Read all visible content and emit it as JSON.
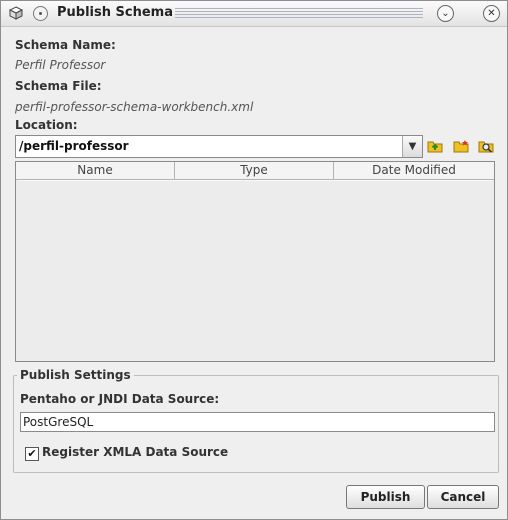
{
  "window": {
    "title": "Publish Schema",
    "icons": {
      "app": "cube-icon",
      "menu": "circle-menu-icon",
      "chevron": "chevron-down-icon",
      "close": "close-icon"
    }
  },
  "schema": {
    "name_label": "Schema Name:",
    "name_value": "Perfil Professor",
    "file_label": "Schema File:",
    "file_value": "perfil-professor-schema-workbench.xml"
  },
  "location": {
    "label": "Location:",
    "value": "/perfil-professor",
    "tools": [
      "folder-up-icon",
      "new-folder-icon",
      "search-folder-icon"
    ]
  },
  "table": {
    "columns": [
      "Name",
      "Type",
      "Date Modified"
    ],
    "rows": []
  },
  "publish_settings": {
    "title": "Publish Settings",
    "datasource_label": "Pentaho or JNDI Data Source:",
    "datasource_value": "PostGreSQL",
    "register_xmla_label": "Register XMLA Data Source",
    "register_xmla_checked": true
  },
  "buttons": {
    "publish": "Publish",
    "cancel": "Cancel"
  },
  "colors": {
    "dialog_bg": "#efefef",
    "folder_yellow": "#f0c020",
    "folder_green": "#3aa53a"
  }
}
